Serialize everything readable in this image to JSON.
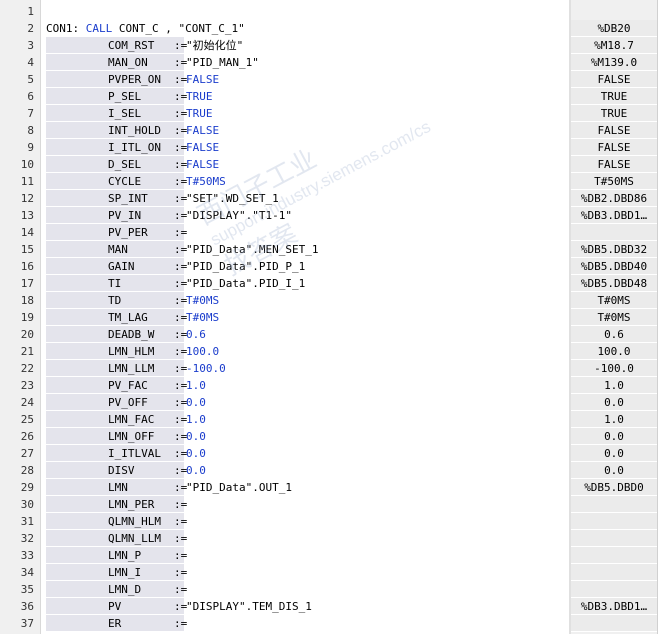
{
  "header_line": {
    "line": "2",
    "label": "CON1:",
    "keyword": "CALL",
    "block": "CONT_C",
    "comma": ",",
    "instance": "\"CONT_C_1\"",
    "value": "%DB20"
  },
  "rows": [
    {
      "line": "1",
      "name": "",
      "assign": "",
      "arg": "",
      "value": "",
      "kind": "blank"
    },
    {
      "line": "3",
      "name": "COM_RST",
      "assign": ":=",
      "arg": "\"初始化位\"",
      "value": "%M18.7",
      "kind": "text"
    },
    {
      "line": "4",
      "name": "MAN_ON",
      "assign": ":=",
      "arg": "\"PID_MAN_1\"",
      "value": "%M139.0",
      "kind": "text"
    },
    {
      "line": "5",
      "name": "PVPER_ON",
      "assign": ":=",
      "arg": "FALSE",
      "value": "FALSE",
      "kind": "kw"
    },
    {
      "line": "6",
      "name": "P_SEL",
      "assign": ":=",
      "arg": "TRUE",
      "value": "TRUE",
      "kind": "kw"
    },
    {
      "line": "7",
      "name": "I_SEL",
      "assign": ":=",
      "arg": "TRUE",
      "value": "TRUE",
      "kind": "kw"
    },
    {
      "line": "8",
      "name": "INT_HOLD",
      "assign": ":=",
      "arg": "FALSE",
      "value": "FALSE",
      "kind": "kw"
    },
    {
      "line": "9",
      "name": "I_ITL_ON",
      "assign": ":=",
      "arg": "FALSE",
      "value": "FALSE",
      "kind": "kw"
    },
    {
      "line": "10",
      "name": "D_SEL",
      "assign": ":=",
      "arg": "FALSE",
      "value": "FALSE",
      "kind": "kw"
    },
    {
      "line": "11",
      "name": "CYCLE",
      "assign": ":=",
      "arg": "T#50MS",
      "value": "T#50MS",
      "kind": "kw"
    },
    {
      "line": "12",
      "name": "SP_INT",
      "assign": ":=",
      "arg": "\"SET\".WD_SET_1",
      "value": "%DB2.DBD86",
      "kind": "text"
    },
    {
      "line": "13",
      "name": "PV_IN",
      "assign": ":=",
      "arg": "\"DISPLAY\".\"T1-1\"",
      "value": "%DB3.DBD1…",
      "kind": "text"
    },
    {
      "line": "14",
      "name": "PV_PER",
      "assign": ":=",
      "arg": "",
      "value": "",
      "kind": "text"
    },
    {
      "line": "15",
      "name": "MAN",
      "assign": ":=",
      "arg": "\"PID_Data\".MEN_SET_1",
      "value": "%DB5.DBD32",
      "kind": "text"
    },
    {
      "line": "16",
      "name": "GAIN",
      "assign": ":=",
      "arg": "\"PID_Data\".PID_P_1",
      "value": "%DB5.DBD40",
      "kind": "text"
    },
    {
      "line": "17",
      "name": "TI",
      "assign": ":=",
      "arg": "\"PID_Data\".PID_I_1",
      "value": "%DB5.DBD48",
      "kind": "text"
    },
    {
      "line": "18",
      "name": "TD",
      "assign": ":=",
      "arg": "T#0MS",
      "value": "T#0MS",
      "kind": "kw"
    },
    {
      "line": "19",
      "name": "TM_LAG",
      "assign": ":=",
      "arg": "T#0MS",
      "value": "T#0MS",
      "kind": "kw"
    },
    {
      "line": "20",
      "name": "DEADB_W",
      "assign": ":=",
      "arg": "0.6",
      "value": "0.6",
      "kind": "kw"
    },
    {
      "line": "21",
      "name": "LMN_HLM",
      "assign": ":=",
      "arg": "100.0",
      "value": "100.0",
      "kind": "kw"
    },
    {
      "line": "22",
      "name": "LMN_LLM",
      "assign": ":=",
      "arg": "-100.0",
      "value": "-100.0",
      "kind": "kw"
    },
    {
      "line": "23",
      "name": "PV_FAC",
      "assign": ":=",
      "arg": "1.0",
      "value": "1.0",
      "kind": "kw"
    },
    {
      "line": "24",
      "name": "PV_OFF",
      "assign": ":=",
      "arg": "0.0",
      "value": "0.0",
      "kind": "kw"
    },
    {
      "line": "25",
      "name": "LMN_FAC",
      "assign": ":=",
      "arg": "1.0",
      "value": "1.0",
      "kind": "kw"
    },
    {
      "line": "26",
      "name": "LMN_OFF",
      "assign": ":=",
      "arg": "0.0",
      "value": "0.0",
      "kind": "kw"
    },
    {
      "line": "27",
      "name": "I_ITLVAL",
      "assign": ":=",
      "arg": "0.0",
      "value": "0.0",
      "kind": "kw"
    },
    {
      "line": "28",
      "name": "DISV",
      "assign": ":=",
      "arg": "0.0",
      "value": "0.0",
      "kind": "kw"
    },
    {
      "line": "29",
      "name": "LMN",
      "assign": ":=",
      "arg": "\"PID_Data\".OUT_1",
      "value": "%DB5.DBD0",
      "kind": "text"
    },
    {
      "line": "30",
      "name": "LMN_PER",
      "assign": ":=",
      "arg": "",
      "value": "",
      "kind": "text"
    },
    {
      "line": "31",
      "name": "QLMN_HLM",
      "assign": ":=",
      "arg": "",
      "value": "",
      "kind": "text"
    },
    {
      "line": "32",
      "name": "QLMN_LLM",
      "assign": ":=",
      "arg": "",
      "value": "",
      "kind": "text"
    },
    {
      "line": "33",
      "name": "LMN_P",
      "assign": ":=",
      "arg": "",
      "value": "",
      "kind": "text"
    },
    {
      "line": "34",
      "name": "LMN_I",
      "assign": ":=",
      "arg": "",
      "value": "",
      "kind": "text"
    },
    {
      "line": "35",
      "name": "LMN_D",
      "assign": ":=",
      "arg": "",
      "value": "",
      "kind": "text"
    },
    {
      "line": "36",
      "name": "PV",
      "assign": ":=",
      "arg": "\"DISPLAY\".TEM_DIS_1",
      "value": "%DB3.DBD1…",
      "kind": "text"
    },
    {
      "line": "37",
      "name": "ER",
      "assign": ":=",
      "arg": "",
      "value": "",
      "kind": "text"
    }
  ],
  "watermark": {
    "line1": "西门子工业",
    "line2": "support.industry.siemens.com/cs",
    "line3": "找答案"
  },
  "colors": {
    "keyword": "#1a3ccc",
    "param_bg": "#e4e4ec",
    "gutter_bg": "#f0f0f0"
  }
}
